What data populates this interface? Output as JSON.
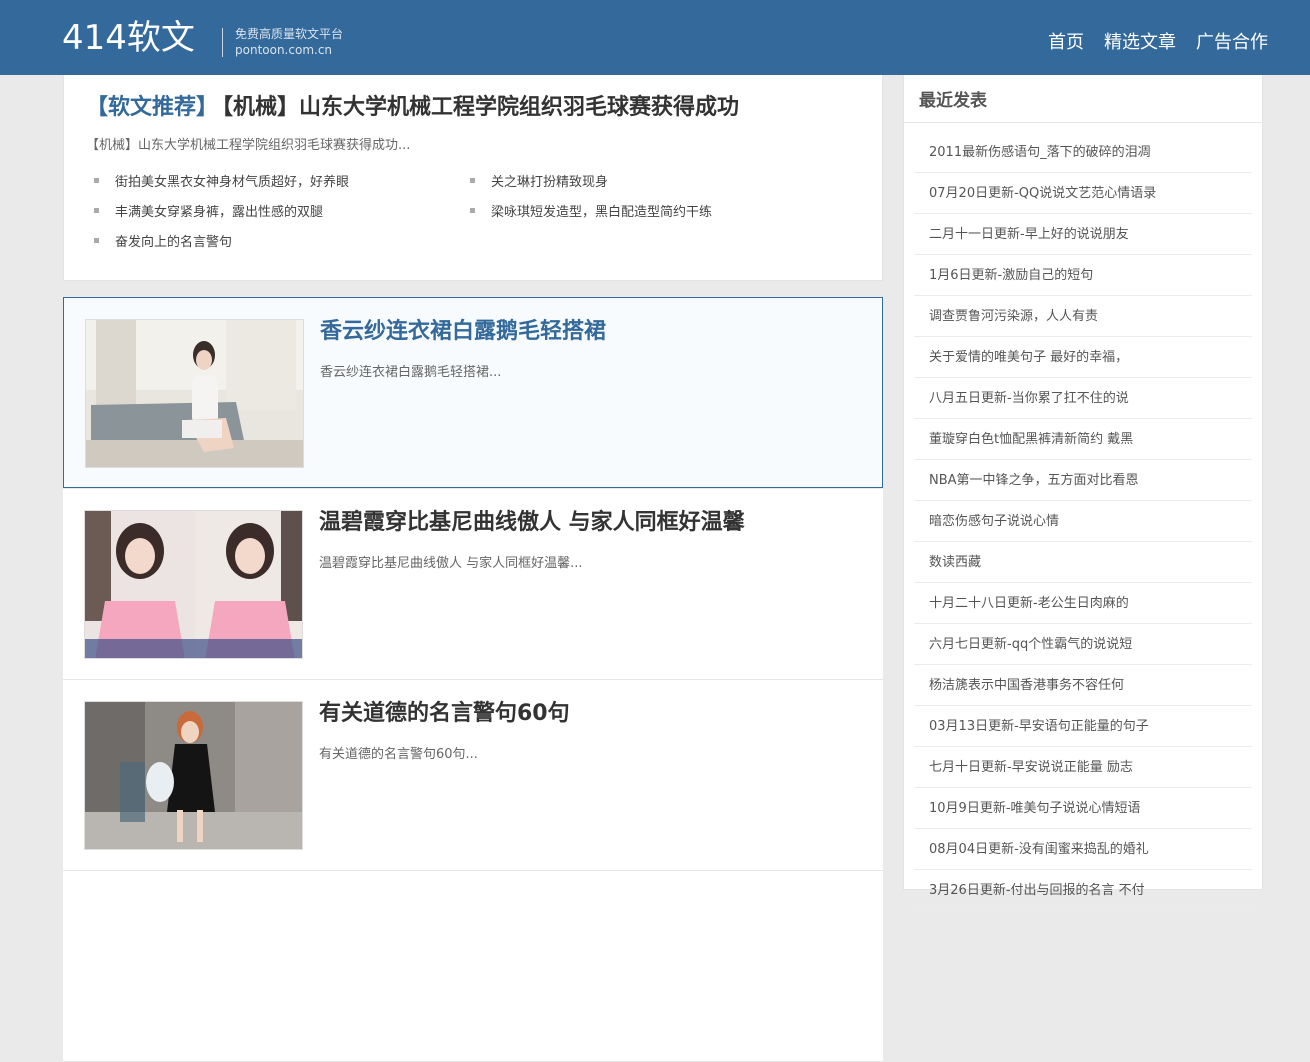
{
  "header": {
    "logo": "414软文",
    "slogan_line1": "免费高质量软文平台",
    "slogan_line2": "pontoon.com.cn",
    "nav": [
      "首页",
      "精选文章",
      "广告合作"
    ]
  },
  "featured": {
    "tag": "【软文推荐】",
    "title": "【机械】山东大学机械工程学院组织羽毛球赛获得成功",
    "desc": "【机械】山东大学机械工程学院组织羽毛球赛获得成功...",
    "related": [
      "街拍美女黑衣女神身材气质超好，好养眼",
      "关之琳打扮精致现身",
      "丰满美女穿紧身裤，露出性感的双腿",
      "梁咏琪短发造型，黑白配造型简约干练",
      "奋发向上的名言警句"
    ]
  },
  "articles": [
    {
      "title": "香云纱连衣裙白露鹅毛轻搭裙",
      "desc": "香云纱连衣裙白露鹅毛轻搭裙..."
    },
    {
      "title": "温碧霞穿比基尼曲线傲人 与家人同框好温馨",
      "desc": "温碧霞穿比基尼曲线傲人 与家人同框好温馨..."
    },
    {
      "title": "有关道德的名言警句60句",
      "desc": "有关道德的名言警句60句..."
    }
  ],
  "sidebar": {
    "title": "最近发表",
    "items": [
      "2011最新伤感语句_落下的破碎的泪凋",
      "07月20日更新-QQ说说文艺范心情语录",
      "二月十一日更新-早上好的说说朋友",
      "1月6日更新-激励自己的短句",
      "调查贾鲁河污染源，人人有责",
      "关于爱情的唯美句子 最好的幸福，",
      "八月五日更新-当你累了扛不住的说",
      "董璇穿白色t恤配黑裤清新简约 戴黑",
      "NBA第一中锋之争，五方面对比看恩",
      "暗恋伤感句子说说心情",
      "数读西藏",
      "十月二十八日更新-老公生日肉麻的",
      "六月七日更新-qq个性霸气的说说短",
      "杨洁篪表示中国香港事务不容任何",
      "03月13日更新-早安语句正能量的句子",
      "七月十日更新-早安说说正能量 励志",
      "10月9日更新-唯美句子说说心情短语",
      "08月04日更新-没有闺蜜来捣乱的婚礼",
      "3月26日更新-付出与回报的名言 不付"
    ]
  }
}
